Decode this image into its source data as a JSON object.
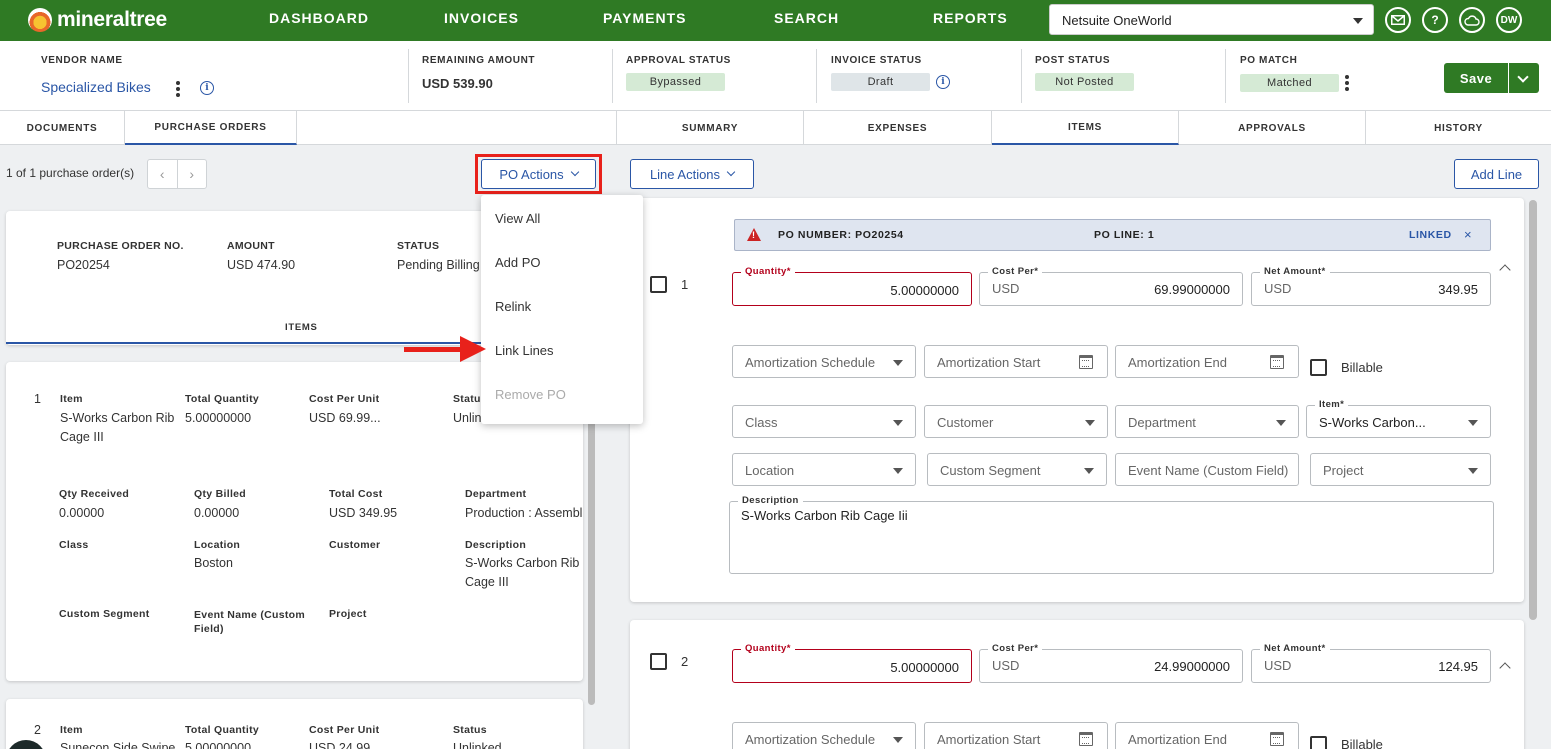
{
  "nav": {
    "brand": "mineraltree",
    "links": [
      "DASHBOARD",
      "INVOICES",
      "PAYMENTS",
      "SEARCH",
      "REPORTS"
    ],
    "org": "Netsuite OneWorld",
    "user_initials": "DW",
    "help_glyph": "?",
    "icons": [
      "mail-icon",
      "help-icon",
      "cloud-icon",
      "avatar-icon"
    ],
    "brand_color": "#2f7a24"
  },
  "header": {
    "vendor_label": "VENDOR NAME",
    "vendor_name": "Specialized Bikes",
    "remaining_label": "REMAINING AMOUNT",
    "remaining_value": "USD  539.90",
    "approval_label": "APPROVAL STATUS",
    "approval_value": "Bypassed",
    "invoice_status_label": "INVOICE STATUS",
    "invoice_status_value": "Draft",
    "post_label": "POST STATUS",
    "post_value": "Not Posted",
    "po_match_label": "PO MATCH",
    "po_match_value": "Matched",
    "save_label": "Save",
    "info_glyph": "i"
  },
  "tabs_left": [
    "DOCUMENTS",
    "PURCHASE ORDERS"
  ],
  "tabs_right": [
    "SUMMARY",
    "EXPENSES",
    "ITEMS",
    "APPROVALS",
    "HISTORY"
  ],
  "left": {
    "po_count": "1 of 1 purchase order(s)",
    "pager_prev": "‹",
    "pager_next": "›",
    "po_actions": "PO Actions",
    "po_card": {
      "po_no_label": "PURCHASE ORDER NO.",
      "po_no": "PO20254",
      "amount_label": "AMOUNT",
      "amount": "USD  474.90",
      "status_label": "STATUS",
      "status": "Pending Billing",
      "items_tab": "ITEMS"
    },
    "line1": {
      "num": "1",
      "item_label": "Item",
      "item": "S-Works Carbon Rib Cage III",
      "tq_label": "Total Quantity",
      "tq": "5.00000000",
      "cpu_label": "Cost Per Unit",
      "cpu": "USD  69.99...",
      "status_label": "Status",
      "status": "Unlin",
      "qr_label": "Qty Received",
      "qr": "0.00000",
      "qb_label": "Qty Billed",
      "qb": "0.00000",
      "tc_label": "Total Cost",
      "tc": "USD  349.95",
      "dept_label": "Department",
      "dept": "Production : Assembl",
      "class_label": "Class",
      "loc_label": "Location",
      "loc": "Boston",
      "cust_label": "Customer",
      "desc_label": "Description",
      "desc": "S-Works Carbon Rib Cage III",
      "cs_label": "Custom Segment",
      "ev_label": "Event Name (Custom Field)",
      "proj_label": "Project"
    },
    "line2": {
      "num": "2",
      "item_label": "Item",
      "item": "Sunecon Side Swipe",
      "tq_label": "Total Quantity",
      "tq": "5.00000000",
      "cpu_label": "Cost Per Unit",
      "cpu": "USD  24.99",
      "status_label": "Status",
      "status": "Unlinked"
    }
  },
  "menu": {
    "items": [
      "View All",
      "Add PO",
      "Relink",
      "Link Lines",
      "Remove PO"
    ]
  },
  "right": {
    "line_actions": "Line Actions",
    "add_line": "Add Line",
    "linked_bar": {
      "po_number": "PO NUMBER: PO20254",
      "po_line": "PO LINE: 1",
      "status": "LINKED",
      "close": "×"
    },
    "line1": {
      "num": "1",
      "quantity_label": "Quantity*",
      "quantity": "5.00000000",
      "cost_label": "Cost Per*",
      "currency": "USD",
      "cost": "69.99000000",
      "net_label": "Net Amount*",
      "net": "349.95",
      "amort_sched": "Amortization Schedule",
      "amort_start": "Amortization Start",
      "amort_end": "Amortization End",
      "billable": "Billable",
      "class": "Class",
      "customer": "Customer",
      "department": "Department",
      "item_label": "Item*",
      "item": "S-Works Carbon...",
      "location": "Location",
      "custom_segment": "Custom Segment",
      "event_name": "Event Name (Custom Field)",
      "project": "Project",
      "desc_label": "Description",
      "desc": "S-Works Carbon Rib Cage Iii"
    },
    "line2": {
      "num": "2",
      "quantity_label": "Quantity*",
      "quantity": "5.00000000",
      "cost_label": "Cost Per*",
      "currency": "USD",
      "cost": "24.99000000",
      "net_label": "Net Amount*",
      "net": "124.95",
      "amort_sched": "Amortization Schedule",
      "amort_start": "Amortization Start",
      "amort_end": "Amortization End",
      "billable": "Billable"
    }
  }
}
